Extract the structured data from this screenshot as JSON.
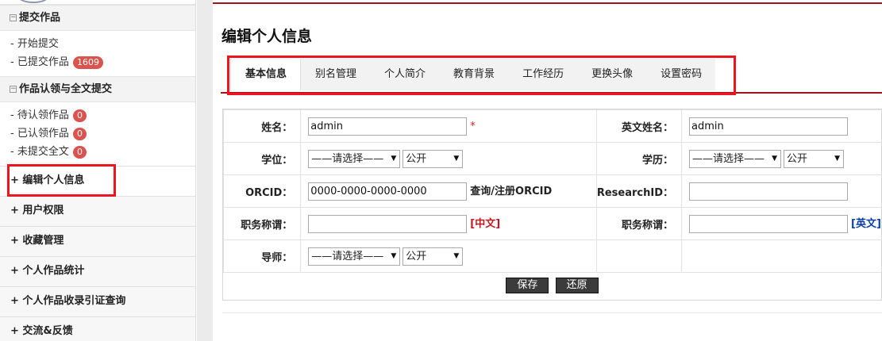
{
  "sidebar": {
    "section_submit": {
      "title": "提交作品",
      "items": [
        {
          "label": "- 开始提交"
        },
        {
          "label": "- 已提交作品",
          "badge": "1609"
        }
      ]
    },
    "section_claim": {
      "title": "作品认领与全文提交",
      "items": [
        {
          "label": "- 待认领作品",
          "badge": "0"
        },
        {
          "label": "- 已认领作品",
          "badge": "0"
        },
        {
          "label": "- 未提交全文",
          "badge": "0"
        }
      ]
    },
    "menu": [
      {
        "label": "+ 编辑个人信息",
        "active": true
      },
      {
        "label": "+ 用户权限"
      },
      {
        "label": "+ 收藏管理"
      },
      {
        "label": "+ 个人作品统计"
      },
      {
        "label": "+ 个人作品收录引证查询"
      },
      {
        "label": "+ 交流&反馈"
      }
    ]
  },
  "main": {
    "title": "编辑个人信息",
    "tabs": [
      "基本信息",
      "别名管理",
      "个人简介",
      "教育背景",
      "工作经历",
      "更换头像",
      "设置密码"
    ],
    "active_tab": "基本信息"
  },
  "form": {
    "name_label": "姓名：",
    "name_value": "admin",
    "required_mark": "*",
    "en_name_label": "英文姓名：",
    "en_name_value": "admin",
    "degree_label": "学位：",
    "degree_select": "——请选择——",
    "degree_visibility": "公开",
    "education_label": "学历：",
    "education_select": "——请选择——",
    "education_visibility": "公开",
    "orcid_label": "ORCID：",
    "orcid_value": "0000-0000-0000-0000",
    "orcid_link": "查询/注册ORCID",
    "researcherid_label": "ResearchID：",
    "researcherid_value": "",
    "title_cn_label": "职务称谓：",
    "title_cn_value": "",
    "title_cn_tag": "[中文]",
    "title_en_label": "职务称谓：",
    "title_en_value": "",
    "title_en_tag": "[英文]",
    "advisor_label": "导师：",
    "advisor_select": "——请选择——",
    "advisor_visibility": "公开",
    "save_label": "保存",
    "reset_label": "还原"
  },
  "colors": {
    "accent": "#a0151c",
    "highlight": "#f0141e",
    "badge": "#d9534f",
    "link_red": "#c8161d",
    "link_blue": "#0a3ea8"
  }
}
